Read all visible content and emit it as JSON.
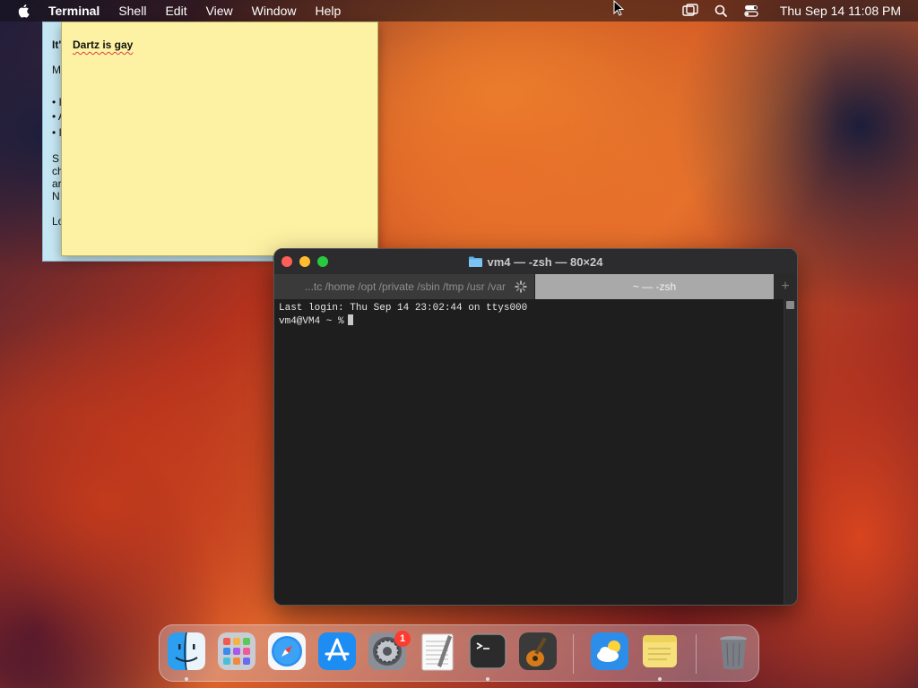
{
  "menubar": {
    "app_name": "Terminal",
    "menus": [
      "Shell",
      "Edit",
      "View",
      "Window",
      "Help"
    ],
    "clock": "Thu Sep 14  11:08 PM",
    "status_icons": [
      "screen-mirroring-icon",
      "search-icon",
      "control-center-icon"
    ]
  },
  "sticky_back": {
    "lines": [
      "It'",
      "M",
      "• I",
      "• A",
      "• I",
      "S",
      "ch",
      "ar",
      "N",
      "Lo"
    ]
  },
  "sticky": {
    "text": "Dartz is gay"
  },
  "terminal": {
    "title": "vm4 — -zsh — 80×24",
    "tabs": [
      {
        "label": "...tc /home /opt /private /sbin /tmp /usr /var"
      },
      {
        "label": "~ — -zsh"
      }
    ],
    "add_tab": "+",
    "lines": [
      "Last login: Thu Sep 14 23:02:44 on ttys000",
      "vm4@VM4 ~ %"
    ]
  },
  "dock": {
    "apps": [
      {
        "name": "Finder",
        "icon": "finder-icon",
        "running": true
      },
      {
        "name": "Launchpad",
        "icon": "launchpad-icon",
        "running": false
      },
      {
        "name": "Safari",
        "icon": "safari-icon",
        "running": false
      },
      {
        "name": "App Store",
        "icon": "app-store-icon",
        "running": false
      },
      {
        "name": "System Settings",
        "icon": "system-settings-icon",
        "running": false,
        "badge": "1"
      },
      {
        "name": "TextEdit",
        "icon": "textedit-icon",
        "running": false
      },
      {
        "name": "Terminal",
        "icon": "terminal-icon",
        "running": true
      },
      {
        "name": "GarageBand",
        "icon": "garageband-icon",
        "running": false
      },
      {
        "name": "Weather",
        "icon": "weather-icon",
        "running": false
      },
      {
        "name": "Stickies",
        "icon": "stickies-icon",
        "running": true
      },
      {
        "name": "Trash",
        "icon": "trash-icon",
        "running": false
      }
    ]
  }
}
